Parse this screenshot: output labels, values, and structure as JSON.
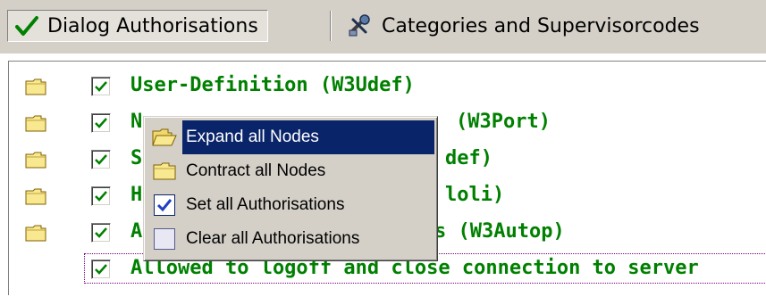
{
  "toolbar": {
    "tabs": [
      {
        "label": "Dialog Authorisations",
        "icon": "checkmark-icon",
        "active": true
      },
      {
        "label": "Categories and Supervisorcodes",
        "icon": "tools-icon",
        "active": false
      }
    ]
  },
  "tree": {
    "items": [
      {
        "label": "User-Definition (W3Udef)",
        "checked": true
      },
      {
        "label": "N",
        "checked": true
      },
      {
        "label": "S",
        "checked": true
      },
      {
        "label": "H",
        "checked": true
      },
      {
        "label": "A",
        "checked": true
      },
      {
        "label": "Allowed to logoff and close connection to server",
        "checked": true,
        "focused": true
      }
    ],
    "partial_right": [
      "(W3Port)",
      "def)",
      "loli)",
      "s (W3Autop)"
    ]
  },
  "context_menu": {
    "items": [
      {
        "label": "Expand all Nodes",
        "icon": "open-folder-icon",
        "highlighted": true
      },
      {
        "label": "Contract all Nodes",
        "icon": "folder-icon"
      },
      {
        "label": "Set all Authorisations",
        "icon": "checked-box-icon"
      },
      {
        "label": "Clear all Authorisations",
        "icon": "empty-box-icon"
      }
    ]
  },
  "colors": {
    "label_green": "#008000",
    "highlight": "#0a246a",
    "chrome": "#d4d0c8"
  }
}
